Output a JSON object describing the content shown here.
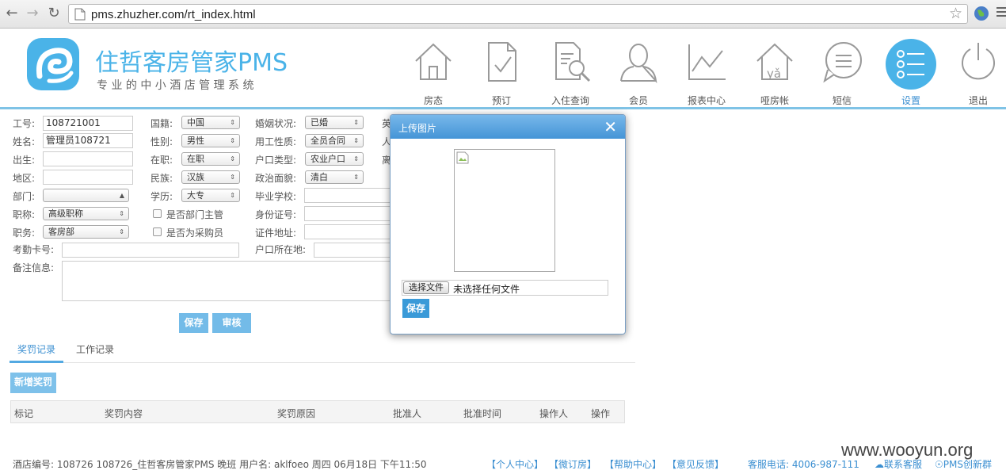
{
  "browser": {
    "url": "pms.zhuzher.com/rt_index.html"
  },
  "brand": {
    "title": "住哲客房管家PMS",
    "subtitle": "专 业 的 中 小 酒 店 管 理 系 统",
    "color": "#4ab3e8"
  },
  "nav": [
    {
      "label": "房态",
      "icon": "house-icon"
    },
    {
      "label": "预订",
      "icon": "document-check-icon"
    },
    {
      "label": "入住查询",
      "icon": "document-search-icon"
    },
    {
      "label": "会员",
      "icon": "user-icon"
    },
    {
      "label": "报表中心",
      "icon": "line-chart-icon"
    },
    {
      "label": "哑房帐",
      "icon": "house-ya-icon",
      "glyph": "yǎ"
    },
    {
      "label": "短信",
      "icon": "message-icon"
    },
    {
      "label": "设置",
      "icon": "settings-list-icon",
      "active": true
    },
    {
      "label": "退出",
      "icon": "power-icon"
    }
  ],
  "form": {
    "col1": {
      "emp_no_label": "工号:",
      "emp_no_value": "108721001",
      "name_label": "姓名:",
      "name_value": "管理员108721",
      "birth_label": "出生:",
      "region_label": "地区:",
      "dept_label": "部门:",
      "title_label": "职称:",
      "title_value": "高级职称",
      "position_label": "职务:",
      "position_value": "客房部",
      "card_label": "考勤卡号:",
      "remark_label": "备注信息:"
    },
    "col2": {
      "nationality_label": "国籍:",
      "nationality_value": "中国",
      "gender_label": "性别:",
      "gender_value": "男性",
      "employed_label": "在职:",
      "employed_value": "在职",
      "ethnic_label": "民族:",
      "ethnic_value": "汉族",
      "edu_label": "学历:",
      "edu_value": "大专",
      "dept_head_label": "是否部门主管",
      "buyer_label": "是否为采购员"
    },
    "col3": {
      "marital_label": "婚姻状况:",
      "marital_value": "已婚",
      "employ_type_label": "用工性质:",
      "employ_type_value": "全员合同",
      "hukou_type_label": "户口类型:",
      "hukou_type_value": "农业户口",
      "political_label": "政治面貌:",
      "political_value": "清白",
      "school_label": "毕业学校:",
      "id_no_label": "身份证号:",
      "id_addr_label": "证件地址:",
      "hukou_addr_label": "户口所在地:"
    },
    "partial": [
      "英",
      "人",
      "离"
    ],
    "save_label": "保存",
    "audit_label": "审核"
  },
  "tabs": [
    {
      "label": "奖罚记录",
      "active": true
    },
    {
      "label": "工作记录",
      "active": false
    }
  ],
  "rewards": {
    "add_label": "新增奖罚",
    "columns": [
      "标记",
      "奖罚内容",
      "奖罚原因",
      "批准人",
      "批准时间",
      "操作人",
      "操作"
    ]
  },
  "modal": {
    "title": "上传图片",
    "close": "✕",
    "choose_file": "选择文件",
    "no_file": "未选择任何文件",
    "save": "保存"
  },
  "footer": {
    "hotel_info": "酒店编号:  108726  108726_住哲客房管家PMS    晚班    用户名: aklfoeo    周四 06月18日 下午11:50",
    "links": [
      "【个人中心】",
      "【微订房】",
      "【帮助中心】",
      "【意见反馈】"
    ],
    "phone": "客服电话: 4006-987-111",
    "contact": "联系客服",
    "community": "PMS创新群",
    "watermark": "www.wooyun.org"
  },
  "colors": {
    "accent": "#53a9e2",
    "header_line": "#7fc3e6",
    "link": "#3b8fd1"
  }
}
